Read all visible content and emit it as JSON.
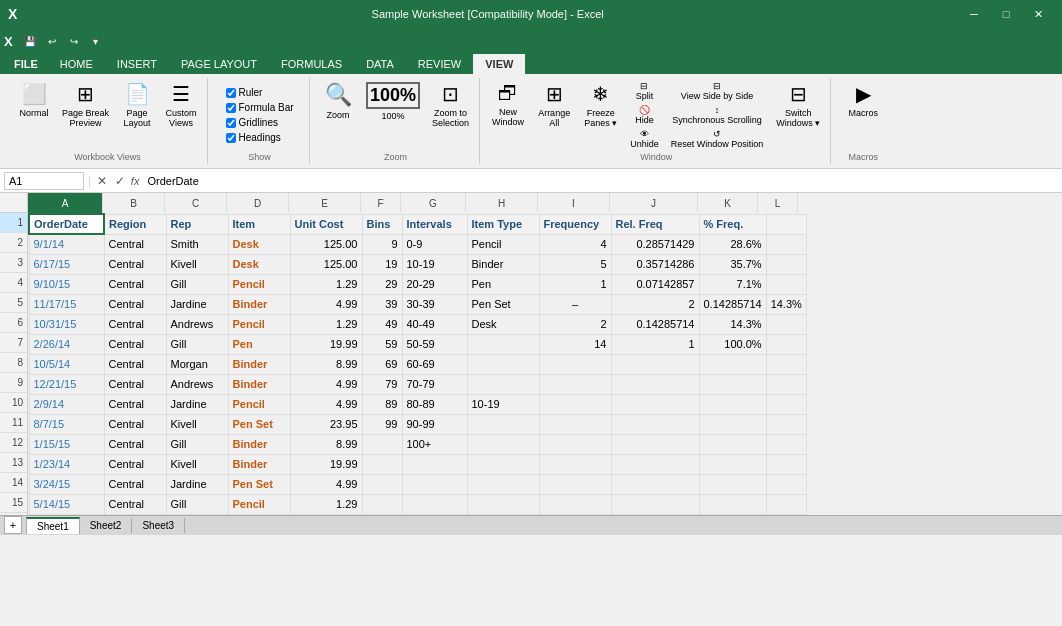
{
  "titleBar": {
    "title": "Sample Worksheet [Compatibility Mode] - Excel",
    "quickAccess": [
      "save",
      "undo",
      "redo",
      "customize"
    ]
  },
  "tabs": [
    "FILE",
    "HOME",
    "INSERT",
    "PAGE LAYOUT",
    "FORMULAS",
    "DATA",
    "REVIEW",
    "VIEW"
  ],
  "activeTab": "VIEW",
  "ribbon": {
    "groups": [
      {
        "name": "workbook-views",
        "label": "Workbook Views",
        "items": [
          {
            "id": "normal",
            "label": "Normal",
            "icon": "▦"
          },
          {
            "id": "page-break",
            "label": "Page Break Preview",
            "icon": "⊞"
          },
          {
            "id": "page-layout",
            "label": "Page Layout",
            "icon": "📄"
          },
          {
            "id": "custom-views",
            "label": "Custom Views",
            "icon": "☰"
          }
        ]
      },
      {
        "name": "show",
        "label": "Show",
        "checkboxes": [
          {
            "id": "ruler",
            "label": "Ruler",
            "checked": true
          },
          {
            "id": "formula-bar",
            "label": "Formula Bar",
            "checked": true
          },
          {
            "id": "gridlines",
            "label": "Gridlines",
            "checked": true
          },
          {
            "id": "headings",
            "label": "Headings",
            "checked": true
          }
        ]
      },
      {
        "name": "zoom",
        "label": "Zoom",
        "items": [
          {
            "id": "zoom",
            "label": "Zoom",
            "icon": "🔍"
          },
          {
            "id": "zoom-100",
            "label": "100%",
            "icon": "1̲0̲0̲"
          },
          {
            "id": "zoom-selection",
            "label": "Zoom to Selection",
            "icon": "⊡"
          }
        ]
      },
      {
        "name": "window",
        "label": "Window",
        "items": [
          {
            "id": "new-window",
            "label": "New Window",
            "icon": "🗗"
          },
          {
            "id": "arrange-all",
            "label": "Arrange All",
            "icon": "⊞"
          },
          {
            "id": "freeze-panes",
            "label": "Freeze Panes",
            "icon": "❄"
          },
          {
            "id": "split",
            "label": "Split",
            "icon": "⊟"
          },
          {
            "id": "hide",
            "label": "Hide",
            "icon": "🚫"
          },
          {
            "id": "unhide",
            "label": "Unhide",
            "icon": "👁"
          },
          {
            "id": "view-side-by-side",
            "label": "View Side by Side",
            "icon": "⊟"
          },
          {
            "id": "sync-scroll",
            "label": "Synchronous Scrolling",
            "icon": "↕"
          },
          {
            "id": "reset-window",
            "label": "Reset Window Position",
            "icon": "↺"
          },
          {
            "id": "switch-windows",
            "label": "Switch Windows",
            "icon": "⊟"
          }
        ]
      },
      {
        "name": "macros",
        "label": "Macros",
        "items": [
          {
            "id": "macros",
            "label": "Macros",
            "icon": "▶"
          }
        ]
      }
    ]
  },
  "formulaBar": {
    "nameBox": "A1",
    "formula": "OrderDate"
  },
  "sheet": {
    "columns": [
      "A",
      "B",
      "C",
      "D",
      "E",
      "F",
      "G",
      "H",
      "I",
      "J",
      "K",
      "L"
    ],
    "activeCell": "A1",
    "rows": [
      [
        "OrderDate",
        "Region",
        "Rep",
        "Item",
        "Unit Cost",
        "Bins",
        "Intervals",
        "Item Type",
        "Frequency",
        "Rel. Freq",
        "% Freq.",
        ""
      ],
      [
        "9/1/14",
        "Central",
        "Smith",
        "Desk",
        "125.00",
        "9",
        "0-9",
        "Pencil",
        "4",
        "0.28571429",
        "28.6%",
        ""
      ],
      [
        "6/17/15",
        "Central",
        "Kivell",
        "Desk",
        "125.00",
        "19",
        "10-19",
        "Binder",
        "5",
        "0.35714286",
        "35.7%",
        ""
      ],
      [
        "9/10/15",
        "Central",
        "Gill",
        "Pencil",
        "1.29",
        "29",
        "20-29",
        "Pen",
        "1",
        "0.07142857",
        "7.1%",
        ""
      ],
      [
        "11/17/15",
        "Central",
        "Jardine",
        "Binder",
        "4.99",
        "39",
        "30-39",
        "Pen Set",
        "",
        "2",
        "0.14285714",
        "14.3%"
      ],
      [
        "10/31/15",
        "Central",
        "Andrews",
        "Pencil",
        "1.29",
        "49",
        "40-49",
        "Desk",
        "2",
        "0.14285714",
        "14.3%",
        ""
      ],
      [
        "2/26/14",
        "Central",
        "Gill",
        "Pen",
        "19.99",
        "59",
        "50-59",
        "",
        "14",
        "1",
        "100.0%",
        ""
      ],
      [
        "10/5/14",
        "Central",
        "Morgan",
        "Binder",
        "8.99",
        "69",
        "60-69",
        "",
        "",
        "",
        "",
        ""
      ],
      [
        "12/21/15",
        "Central",
        "Andrews",
        "Binder",
        "4.99",
        "79",
        "70-79",
        "",
        "",
        "",
        "",
        ""
      ],
      [
        "2/9/14",
        "Central",
        "Jardine",
        "Pencil",
        "4.99",
        "89",
        "80-89",
        "10-19",
        "",
        "",
        "",
        ""
      ],
      [
        "8/7/15",
        "Central",
        "Kivell",
        "Pen Set",
        "23.95",
        "99",
        "90-99",
        "",
        "",
        "",
        "",
        ""
      ],
      [
        "1/15/15",
        "Central",
        "Gill",
        "Binder",
        "8.99",
        "",
        "100+",
        "",
        "",
        "",
        "",
        ""
      ],
      [
        "1/23/14",
        "Central",
        "Kivell",
        "Binder",
        "19.99",
        "",
        "",
        "",
        "",
        "",
        "",
        ""
      ],
      [
        "3/24/15",
        "Central",
        "Jardine",
        "Pen Set",
        "4.99",
        "",
        "",
        "",
        "",
        "",
        "",
        ""
      ],
      [
        "5/14/15",
        "Central",
        "Gill",
        "Pencil",
        "1.29",
        "",
        "",
        "",
        "",
        "",
        "",
        ""
      ]
    ]
  }
}
